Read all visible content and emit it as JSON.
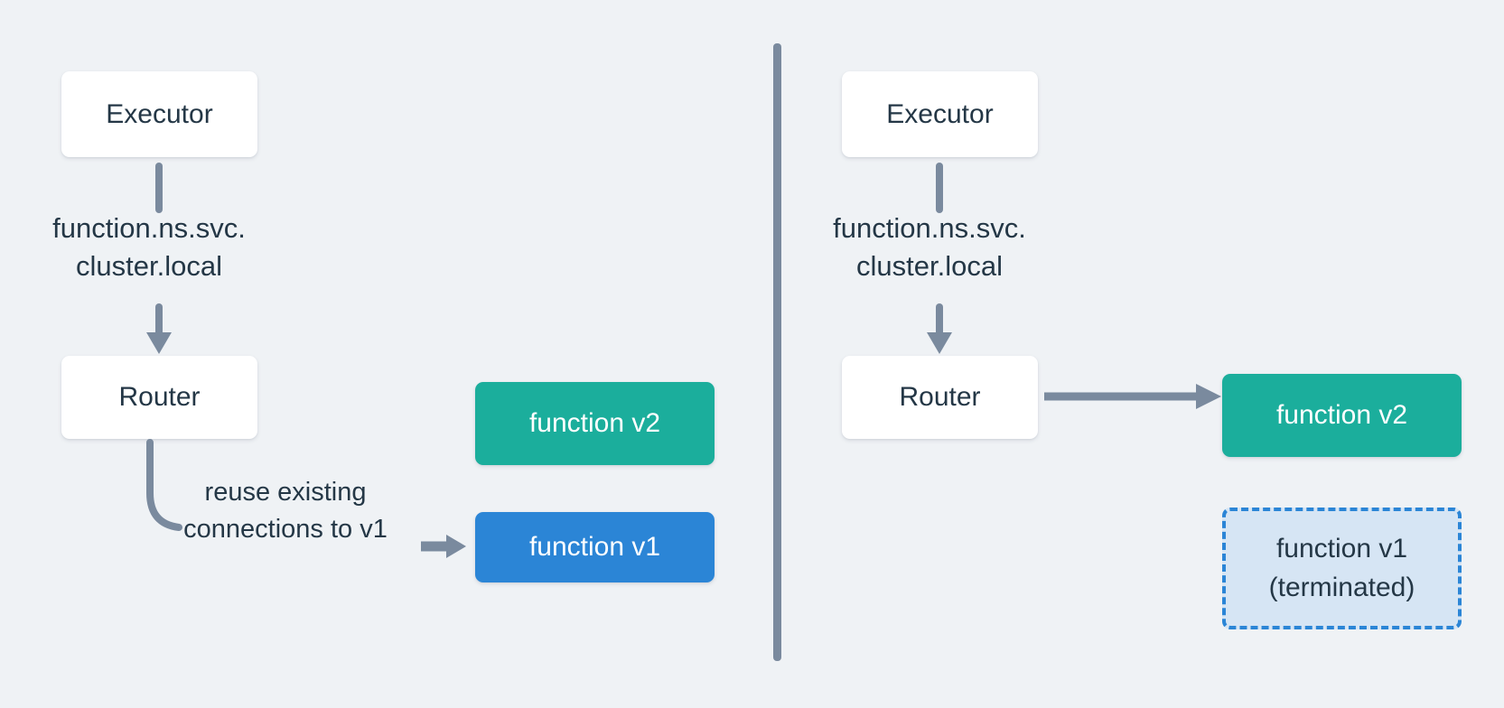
{
  "diagram": {
    "background_color": "#eff2f5",
    "divider_color": "#7a8a9e",
    "arrow_color": "#7a8a9e",
    "text_color": "#243746",
    "colors": {
      "green": "#1bae9c",
      "blue": "#2b85d6",
      "dashed_fill": "#d6e5f4",
      "dashed_border": "#2b85d6",
      "white_box": "#ffffff"
    }
  },
  "left_panel": {
    "executor": "Executor",
    "dns_label": "function.ns.svc.\ncluster.local",
    "router": "Router",
    "function_v2": "function v2",
    "function_v1": "function v1",
    "note": "reuse existing\nconnections to v1"
  },
  "right_panel": {
    "executor": "Executor",
    "dns_label": "function.ns.svc.\ncluster.local",
    "router": "Router",
    "function_v2": "function v2",
    "function_v1_terminated_line1": "function v1",
    "function_v1_terminated_line2": "(terminated)"
  }
}
